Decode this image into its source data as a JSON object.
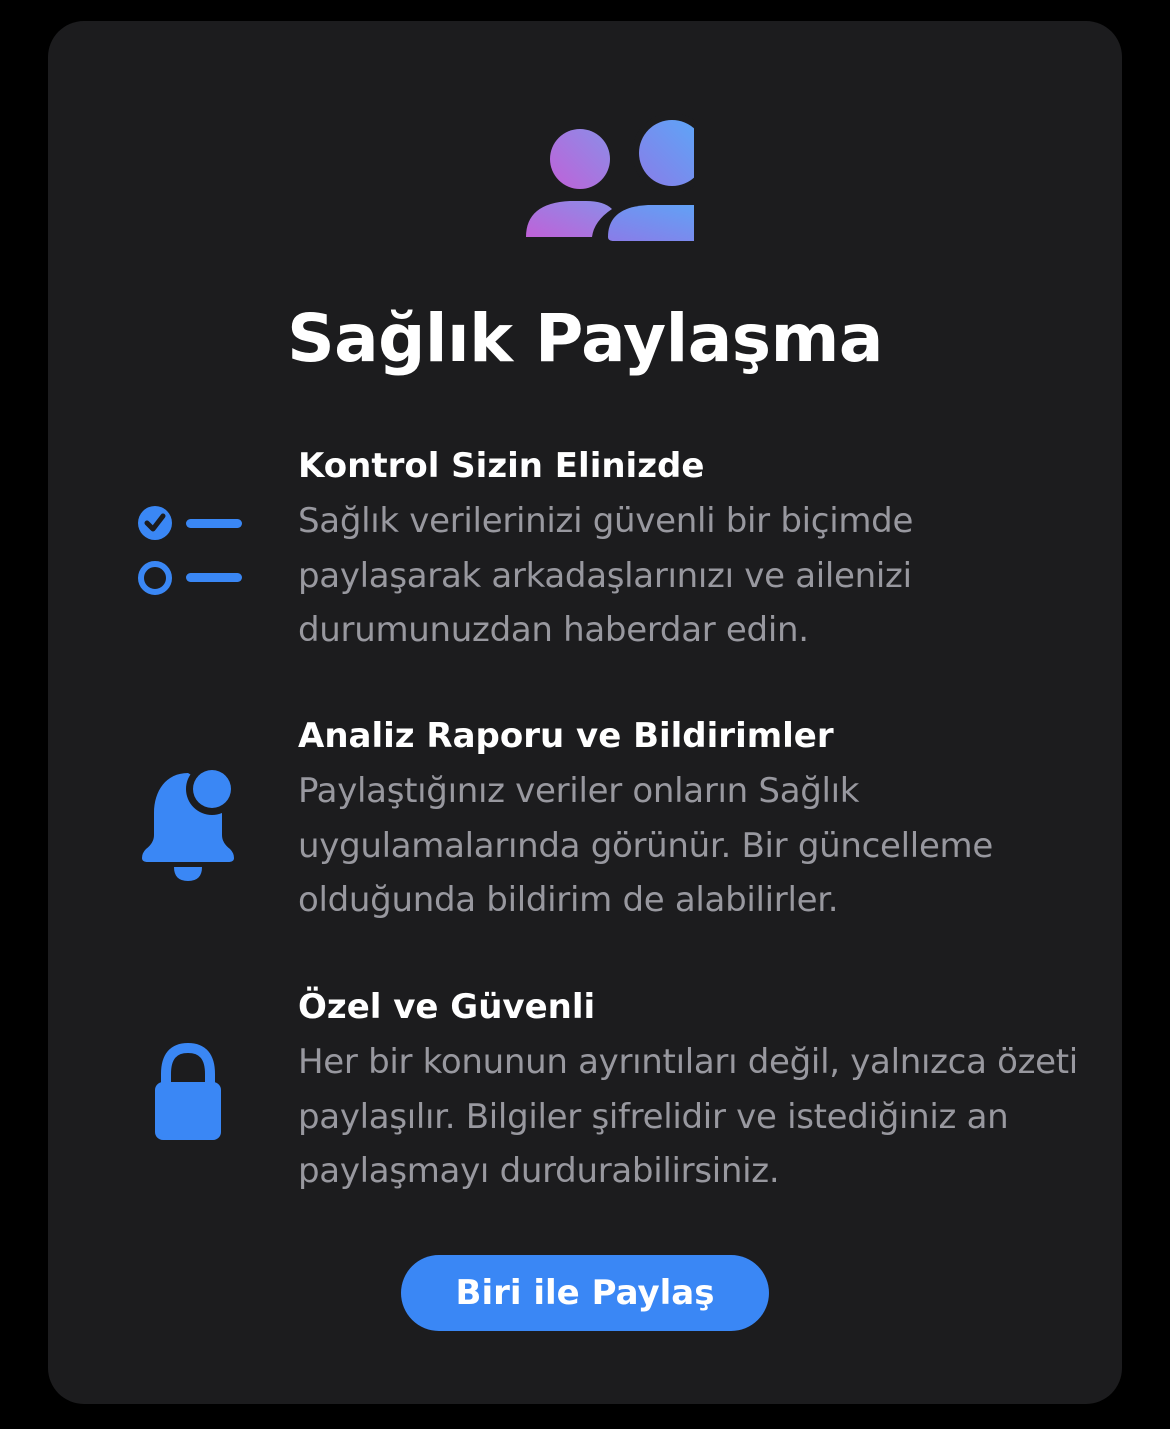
{
  "title": "Sağlık Paylaşma",
  "hero": {
    "icon": "people-icon"
  },
  "features": [
    {
      "icon": "checklist-icon",
      "heading": "Kontrol Sizin Elinizde",
      "body": "Sağlık verilerinizi güvenli bir biçimde paylaşarak arkadaşlarınızı ve ailenizi durumunuzdan haberdar edin."
    },
    {
      "icon": "bell-badge-icon",
      "heading": "Analiz Raporu ve Bildirimler",
      "body": "Paylaştığınız veriler onların Sağlık uygulamalarında görünür. Bir güncelleme olduğunda bildirim de alabilirler."
    },
    {
      "icon": "lock-icon",
      "heading": "Özel ve Güvenli",
      "body": "Her bir konunun ayrıntıları değil, yalnızca özeti paylaşılır. Bilgiler şifrelidir ve istediğiniz an paylaşmayı durdurabilirsiniz."
    }
  ],
  "button": {
    "label": "Biri ile Paylaş"
  },
  "colors": {
    "background": "#000000",
    "card": "#1c1c1e",
    "accent": "#3a87f5",
    "heading": "#ffffff",
    "body_text": "#98989f",
    "hero_gradient_start": "#c061d8",
    "hero_gradient_end": "#5aa8f8"
  }
}
